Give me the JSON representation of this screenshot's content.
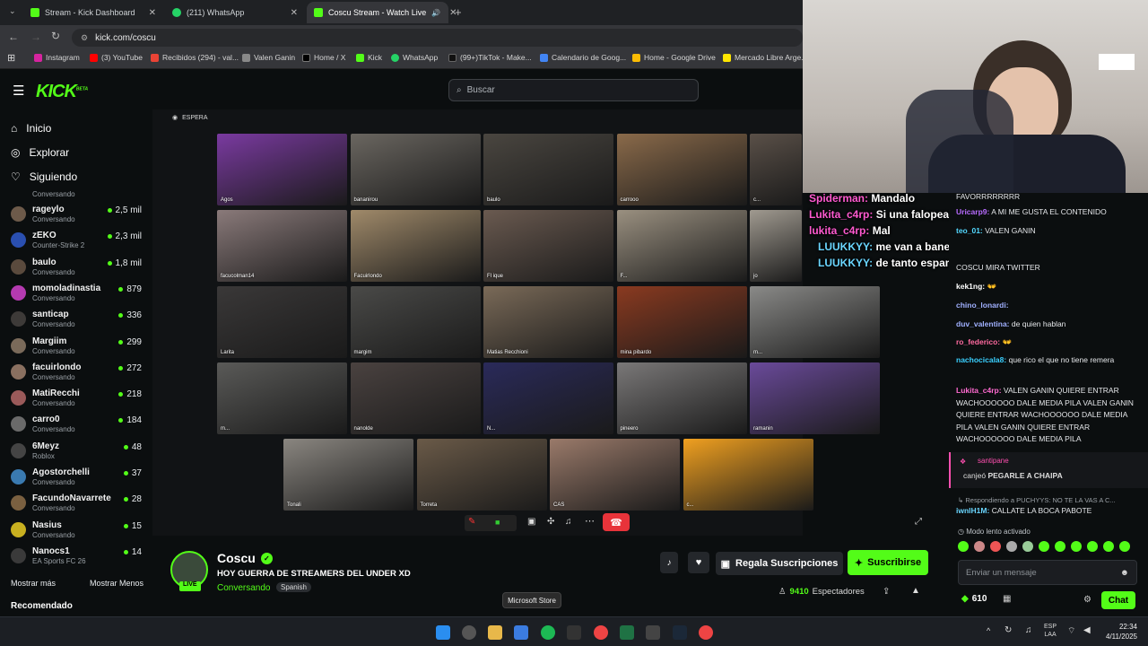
{
  "browser": {
    "tabs": [
      {
        "label": "Stream - Kick Dashboard",
        "color": "#53fc18"
      },
      {
        "label": "(211) WhatsApp",
        "color": "#25d366"
      },
      {
        "label": "Coscu Stream - Watch Live",
        "color": "#53fc18"
      }
    ],
    "url": "kick.com/coscu",
    "bookmarks": [
      {
        "label": "Instagram",
        "color": "#d6249f"
      },
      {
        "label": "(3) YouTube",
        "color": "#ff0000"
      },
      {
        "label": "Recibidos (294) - val...",
        "color": "#ea4335"
      },
      {
        "label": "Valen Ganin",
        "color": "#888888"
      },
      {
        "label": "Home / X",
        "color": "#000000"
      },
      {
        "label": "Kick",
        "color": "#53fc18"
      },
      {
        "label": "WhatsApp",
        "color": "#25d366"
      },
      {
        "label": "(99+)TikTok - Make...",
        "color": "#111111"
      },
      {
        "label": "Calendario de Goog...",
        "color": "#4285f4"
      },
      {
        "label": "Home - Google Drive",
        "color": "#fbbc04"
      },
      {
        "label": "Mercado Libre Arge...",
        "color": "#ffe600"
      }
    ]
  },
  "header": {
    "logo": "KICK",
    "logo_badge": "BETA",
    "search_placeholder": "Buscar"
  },
  "sidebar": {
    "nav": [
      "Inicio",
      "Explorar",
      "Siguiendo"
    ],
    "partial_top": "Conversando",
    "channels": [
      {
        "name": "rageylo",
        "category": "Conversando",
        "viewers": "2,5 mil",
        "color": "#6d5a4a"
      },
      {
        "name": "zEKO",
        "category": "Counter-Strike 2",
        "viewers": "2,3 mil",
        "color": "#2a4fb0"
      },
      {
        "name": "baulo",
        "category": "Conversando",
        "viewers": "1,8 mil",
        "color": "#5a4a3d"
      },
      {
        "name": "momoladinastia",
        "category": "Conversando",
        "viewers": "879",
        "color": "#b43ab0"
      },
      {
        "name": "santicap",
        "category": "Conversando",
        "viewers": "336",
        "color": "#3d3a38"
      },
      {
        "name": "Margiim",
        "category": "Conversando",
        "viewers": "299",
        "color": "#7a6a5a"
      },
      {
        "name": "facuirlondo",
        "category": "Conversando",
        "viewers": "272",
        "color": "#8a7060"
      },
      {
        "name": "MatiRecchi",
        "category": "Conversando",
        "viewers": "218",
        "color": "#9a5a5a"
      },
      {
        "name": "carro0",
        "category": "Conversando",
        "viewers": "184",
        "color": "#6a6a6a"
      },
      {
        "name": "6Meyz",
        "category": "Roblox",
        "viewers": "48",
        "color": "#444444"
      },
      {
        "name": "Agostorchelli",
        "category": "Conversando",
        "viewers": "37",
        "color": "#3a7ab0"
      },
      {
        "name": "FacundoNavarrete",
        "category": "Conversando",
        "viewers": "28",
        "color": "#7a6040"
      },
      {
        "name": "Nasius",
        "category": "Conversando",
        "viewers": "15",
        "color": "#c8b020"
      },
      {
        "name": "Nanocs1",
        "category": "EA Sports FC 26",
        "viewers": "14",
        "color": "#3a3a3a"
      }
    ],
    "show_more": "Mostrar más",
    "show_less": "Mostrar Menos",
    "recommended": "Recomendado"
  },
  "video": {
    "status": "ESPERA",
    "tiles": [
      {
        "name": "Agos",
        "color": "#7a3aa0"
      },
      {
        "name": "bananirou",
        "color": "#6a6660"
      },
      {
        "name": "baulo",
        "color": "#4a4640"
      },
      {
        "name": "carrooo",
        "color": "#8a6a4a"
      },
      {
        "name": "c...",
        "color": "#5a5048"
      },
      {
        "name": "facucolman14",
        "color": "#8a7a7a"
      },
      {
        "name": "Facuirlondo",
        "color": "#a08a6a"
      },
      {
        "name": "Fl ique",
        "color": "#6a5a50"
      },
      {
        "name": "F...",
        "color": "#9a9080"
      },
      {
        "name": "jo",
        "color": "#a09a90"
      },
      {
        "name": "Larita",
        "color": "#3a3838"
      },
      {
        "name": "margim",
        "color": "#4a4a48"
      },
      {
        "name": "Matias Recchioni",
        "color": "#7a6a58"
      },
      {
        "name": "mina pibardo",
        "color": "#8a3a20"
      },
      {
        "name": "m...",
        "color": "#8a8a88"
      },
      {
        "name": "m...",
        "color": "#5a5a58"
      },
      {
        "name": "nanolde",
        "color": "#4a4240"
      },
      {
        "name": "N...",
        "color": "#2a2a5a"
      },
      {
        "name": "pineero",
        "color": "#7a7878"
      },
      {
        "name": "ramanin",
        "color": "#6a4a9a"
      },
      {
        "name": "Tonali",
        "color": "#8a8680"
      },
      {
        "name": "Torreta",
        "color": "#6a5a48"
      },
      {
        "name": "CAS",
        "color": "#9a7a6a"
      },
      {
        "name": "c...",
        "color": "#f0a020"
      }
    ],
    "overlay_chat": [
      {
        "user": "Spiderman:",
        "text": "Mandalo",
        "color": "#ff5ad0"
      },
      {
        "user": "Lukita_c4rp:",
        "text": "Si una falopeada",
        "color": "#ff5ad0"
      },
      {
        "user": "lukita_c4rp:",
        "text": "Mal",
        "color": "#ff5ad0"
      },
      {
        "user": "LUUKKYY:",
        "text": "me van a banear boludo",
        "color": "#6ad6ff"
      },
      {
        "user": "LUUKKYY:",
        "text": "de tanto espamear",
        "color": "#6ad6ff"
      }
    ]
  },
  "channel": {
    "name": "Coscu",
    "live_label": "LIVE",
    "title": "HOY GUERRA DE STREAMERS DEL UNDER XD",
    "category": "Conversando",
    "language": "Spanish",
    "gift_label": "Regala Suscripciones",
    "subscribe_label": "Suscribirse",
    "viewers": "9410",
    "viewers_label": "Espectadores"
  },
  "chat": {
    "messages": [
      {
        "user": "",
        "text": "FAVORRRRRRRR",
        "color": "#cfcfcf"
      },
      {
        "user": "Uricarp9:",
        "text": "A MI ME GUSTA EL CONTENIDO",
        "color": "#b86bff"
      },
      {
        "user": "teo_01:",
        "text": "VALEN GANIN",
        "color": "#53d8ff"
      },
      {
        "user": "",
        "text": "COSCU MIRA TWITTER",
        "color": "#cfcfcf"
      },
      {
        "user": "kek1ng:",
        "text": "👐",
        "color": "#ffffff"
      },
      {
        "user": "chino_lonardi:",
        "text": "",
        "color": "#a0b0ff"
      },
      {
        "user": "duv_valentina:",
        "text": "de quien hablan",
        "color": "#a0b0ff"
      },
      {
        "user": "ro_federico:",
        "text": "👐",
        "color": "#ff6aa0"
      },
      {
        "user": "nachocicala8:",
        "text": "que rico el que no tiene remera",
        "color": "#3ad0ff"
      },
      {
        "user": "Lukita_c4rp:",
        "text": "VALEN GANIN QUIERE ENTRAR WACHOOOOOO DALE MEDIA PILA VALEN GANIN QUIERE ENTRAR WACHOOOOOO DALE MEDIA PILA VALEN GANIN QUIERE ENTRAR WACHOOOOOO DALE MEDIA PILA",
        "color": "#ff6ad0"
      }
    ],
    "redeem_user": "santipane",
    "redeem_prefix": "canjeó",
    "redeem_item": "PEGARLE A CHAIPA",
    "reply_to": "Respondiendo a PUCHYYS: NO TE LA VAS A C...",
    "reply_user": "iwnlH1M:",
    "reply_text": "CALLATE LA BOCA PABOTE",
    "slow_mode": "Modo lento activado",
    "input_placeholder": "Enviar un mensaje",
    "points": "610",
    "chat_button": "Chat"
  },
  "taskbar": {
    "tooltip": "Microsoft Store",
    "lang": "ESP",
    "lang2": "LAA",
    "time": "22:34",
    "date": "4/11/2025"
  }
}
